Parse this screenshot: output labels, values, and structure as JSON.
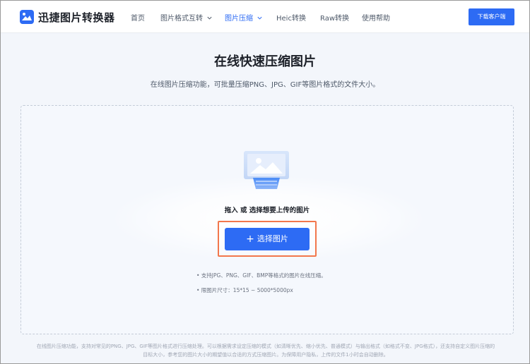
{
  "header": {
    "brand": "迅捷图片转换器",
    "nav": [
      {
        "label": "首页"
      },
      {
        "label": "图片格式互转",
        "has_dropdown": true
      },
      {
        "label": "图片压缩",
        "has_dropdown": true,
        "active": true
      },
      {
        "label": "Heic转换"
      },
      {
        "label": "Raw转换"
      },
      {
        "label": "使用帮助"
      }
    ],
    "download_label": "下载客户端"
  },
  "hero": {
    "title": "在线快速压缩图片",
    "subtitle": "在线图片压缩功能，可批量压缩PNG、JPG、GIF等图片格式的文件大小。"
  },
  "upload": {
    "drop_text": "拖入 或 选择想要上传的图片",
    "button_label": "选择图片",
    "button_icon": "plus-icon",
    "notes": [
      "• 支持JPG、PNG、GIF、BMP等格式的图片在线压缩。",
      "• 限图片尺寸：15*15 ~ 5000*5000px"
    ]
  },
  "footer": {
    "text": "在线图片压缩功能，支持对常见的PNG、JPG、GIF等图片格式进行压缩处理。可以根据需求设定压缩的模式（如清晰优先、缩小优先、普通模式）与输出格式（如格式不变、JPG格式），还支持自定义图片压缩的目标大小，参考您的图片大小的期望值以合适的方式压缩图片。为保障用户隐私，上传的文件1小时会自动删除。"
  },
  "colors": {
    "accent": "#2d6bf4",
    "highlight_border": "#f2774c",
    "page_bg": "#f3f6fb"
  }
}
